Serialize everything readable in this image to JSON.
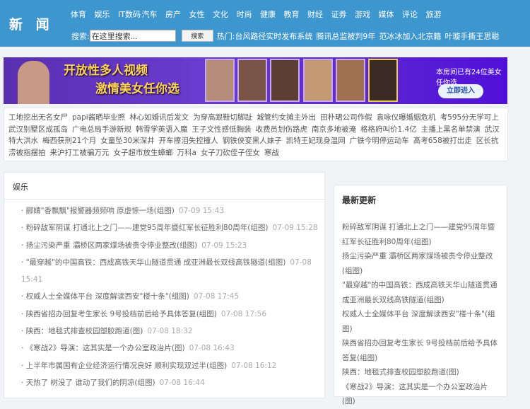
{
  "header": {
    "logo": "新 闻",
    "nav": [
      "体育",
      "娱乐",
      "IT数码",
      "汽车",
      "房产",
      "女性",
      "文化",
      "时尚",
      "健康",
      "教育",
      "财经",
      "证券",
      "游戏",
      "媒体",
      "评论",
      "旅游"
    ],
    "search_label": "搜索:",
    "search_value": "在这里搜索...",
    "search_button": "搜索",
    "hot_label": "热门:",
    "hot": [
      "台风路径实时发布系统",
      "腾讯总监被判9年",
      "范冰冰加入北京籍",
      "叶璇手撕王思聪"
    ]
  },
  "banner": {
    "line1": "开放性多人视频",
    "line2": "激情美女任你选",
    "count": "本房间已有24位美女任你选",
    "enter": "立即进入"
  },
  "tags": [
    "工地挖出无名女尸",
    "papi酱晒毕业照",
    "林心如婚讯后发文",
    "为穿高跟鞋切脚趾",
    "城管约女摊主外出",
    "田朴珺公司作假",
    "袁咏仪曝婚姻危机",
    "考595分无学可上",
    "武汉别墅区成孤岛",
    "广电总局手游新规",
    "韩雪学英语入魔",
    "王子文性感低胸装",
    "收费员划伤路虎",
    "南京多地被淹",
    "格格府叫价1.4亿",
    "主播上黑名单禁演",
    "武汉特大洪水",
    "梅西获刑21个月",
    "女童坠30米深井",
    "开车擦泪失控撞人",
    "钢铁侠变黑人妹子",
    "凯特王妃现身温网",
    "广铁今明停运动车",
    "高考658被打出走",
    "区长抗涝被指摆拍",
    "来沪打工被骗万元",
    "女子超市放生蟑螂",
    "万科a",
    "女子刀砍侄子侄女",
    "寒战"
  ],
  "left": {
    "title": "娱乐",
    "items": [
      {
        "title": "郦婧\"香飘飘\"报警器频频响 原虚惊一场(组图)",
        "date": "07-09 15:43"
      },
      {
        "title": "粉碎敌军阴谋 打通北上之门——建党95周年暨红军长征胜利80周年(组图)",
        "date": "07-09 15:28"
      },
      {
        "title": "扬尘污染严重 灞桥区两家煤场被责令停业整改(组图)",
        "date": "07-09 15:23"
      },
      {
        "title": "\"最穿越\"的中国高铁：西成高铁天华山隧道贯通 成亚洲最长双线高铁隧道(组图)",
        "date": "07-08 15:41"
      },
      {
        "title": "权威人士全媒体平台 深度解读西安\"楼十条\"(组图)",
        "date": "07-08 17:45"
      },
      {
        "title": "陕西省招办回复考生家长 9号投档前后给予具体答复(组图)",
        "date": "07-08 17:56"
      },
      {
        "title": "陕西：地毯式排查校园塑胶跑道(图)",
        "date": "07-08 18:32"
      },
      {
        "title": "《寒战2》导演：这其实是一个办公室政治片(图)",
        "date": "07-08 16:43"
      },
      {
        "title": "上半年市属国有企业经济运行情况良好 顺利实现双过半(组图)",
        "date": "07-08 16:12"
      },
      {
        "title": "天热了 树没了 谁动了我们的阴凉(组图)",
        "date": "07-08 16:44"
      }
    ]
  },
  "right": {
    "title": "最新更新",
    "items": [
      "粉碎敌军阴谋 打通北上之门——建党95周年暨红军长征胜利80周年(组图)",
      "扬尘污染严重 灞桥区两家煤场被责令停业整改(组图)",
      "\"最穿越\"的中国高铁：西成高铁天华山隧道贯通 成亚洲最长双线高铁隧道(组图)",
      "权威人士全媒体平台 深度解读西安\"楼十条\"(组图)",
      "陕西省招办回复考生家长 9号投档前后给予具体答复(组图)",
      "陕西：地毯式排查校园塑胶跑道(图)",
      "《寒战2》导演：这其实是一个办公室政治片(图)"
    ]
  }
}
